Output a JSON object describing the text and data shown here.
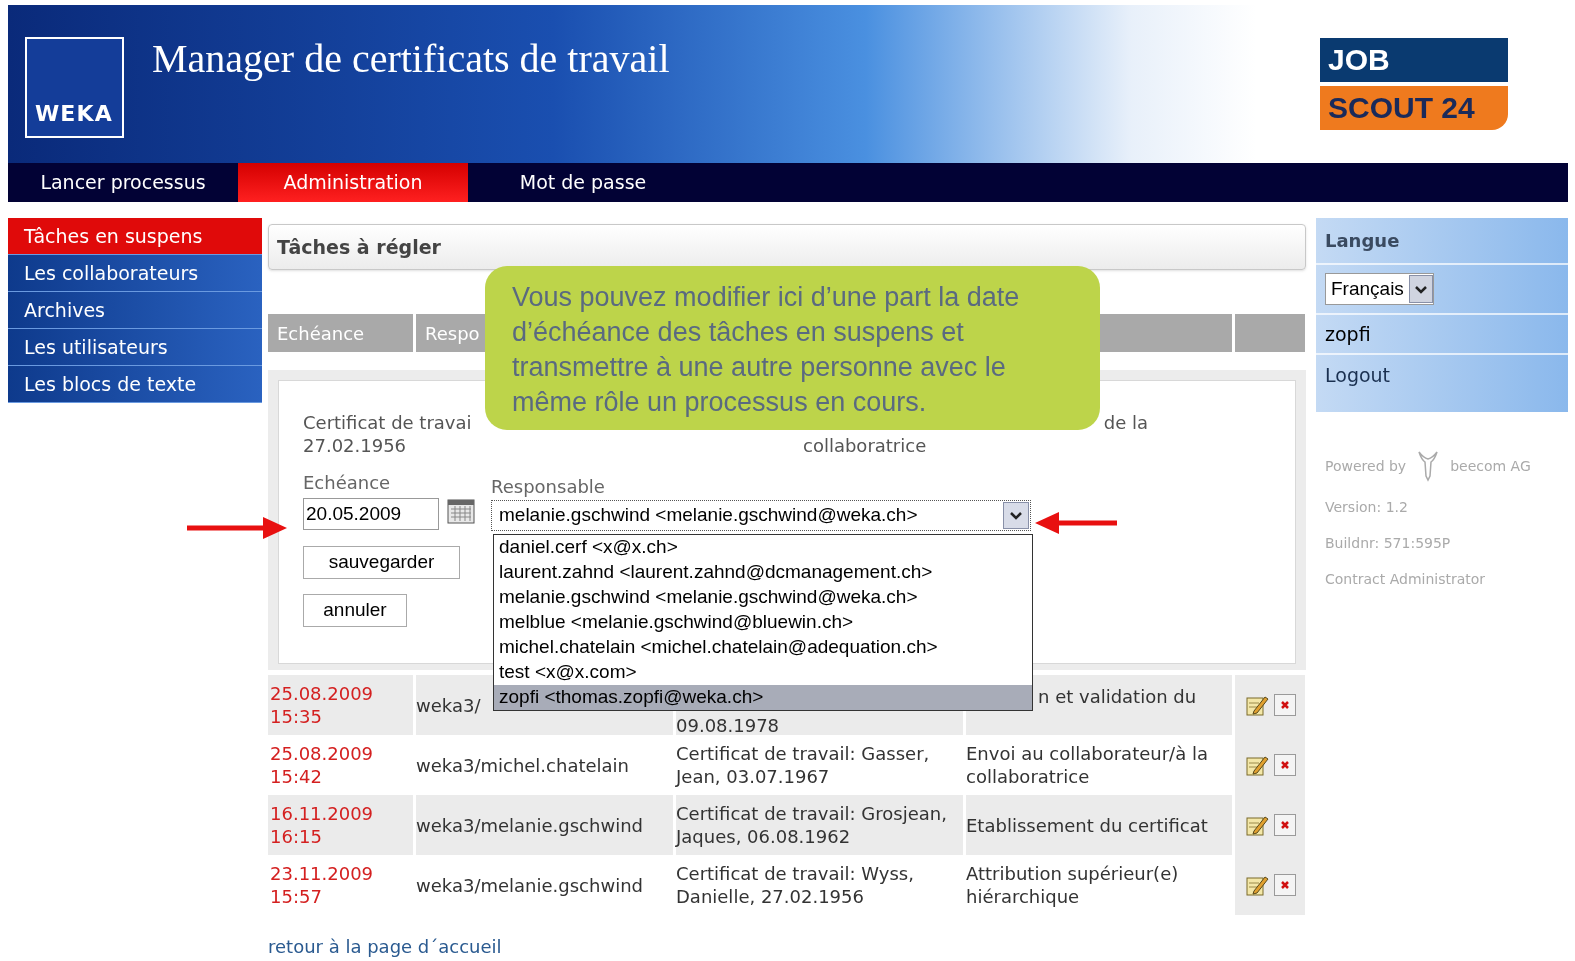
{
  "header": {
    "title": "Manager de certificats de travail",
    "logo_text": "WEKA",
    "partner_logo": {
      "line1": "JOB",
      "line2": "SCOUT 24"
    }
  },
  "nav": [
    {
      "label": "Lancer processus",
      "selected": false
    },
    {
      "label": "Administration",
      "selected": true
    },
    {
      "label": "Mot de passe",
      "selected": false
    }
  ],
  "sidebar": [
    {
      "label": "Tâches en suspens",
      "selected": true
    },
    {
      "label": "Les collaborateurs",
      "selected": false
    },
    {
      "label": "Archives",
      "selected": false
    },
    {
      "label": "Les utilisateurs",
      "selected": false
    },
    {
      "label": "Les blocs de texte",
      "selected": false
    }
  ],
  "panel_title": "Tâches à régler",
  "table": {
    "columns": [
      {
        "label": "Echéance"
      },
      {
        "label": "Respo"
      }
    ],
    "edit_form": {
      "certificate_lines": [
        "Certificat de travai",
        "27.02.1956"
      ],
      "task_lines": [
        "de la",
        "collaboratrice"
      ],
      "due_label": "Echéance",
      "due_value": "20.05.2009",
      "responsible_label": "Responsable",
      "responsible_value": "melanie.gschwind <melanie.gschwind@weka.ch>",
      "buttons": [
        "sauvegarder",
        "annuler"
      ],
      "options": [
        {
          "label": "daniel.cerf <x@x.ch>",
          "selected": false
        },
        {
          "label": "laurent.zahnd <laurent.zahnd@dcmanagement.ch>",
          "selected": false
        },
        {
          "label": "melanie.gschwind <melanie.gschwind@weka.ch>",
          "selected": false
        },
        {
          "label": "melblue <melanie.gschwind@bluewin.ch>",
          "selected": false
        },
        {
          "label": "michel.chatelain <michel.chatelain@adequation.ch>",
          "selected": false
        },
        {
          "label": "test <x@x.com>",
          "selected": false
        },
        {
          "label": "zopfi <thomas.zopfi@weka.ch>",
          "selected": true
        }
      ]
    },
    "rows": [
      {
        "date": "25.08.2009",
        "time": "15:35",
        "user": "weka3/",
        "certificate": "09.08.1978",
        "task": "n et validation du"
      },
      {
        "date": "25.08.2009",
        "time": "15:42",
        "user": "weka3/michel.chatelain",
        "certificate": "Certificat de travail: Gasser, Jean, 03.07.1967",
        "task": "Envoi au collaborateur/à la collaboratrice"
      },
      {
        "date": "16.11.2009",
        "time": "16:15",
        "user": "weka3/melanie.gschwind",
        "certificate": "Certificat de travail: Grosjean, Jaques, 06.08.1962",
        "task": "Etablissement du certificat"
      },
      {
        "date": "23.11.2009",
        "time": "15:57",
        "user": "weka3/melanie.gschwind",
        "certificate": "Certificat de travail: Wyss, Danielle, 27.02.1956",
        "task": "Attribution supérieur(e) hiérarchique"
      }
    ]
  },
  "back_link": "retour à la page d´accueil",
  "right_panel": {
    "language_label": "Langue",
    "language": "Français",
    "user": "zopfi",
    "logout": "Logout",
    "powered_by": "Powered by",
    "company": "beecom AG",
    "info_lines": [
      "Version: 1.2",
      "Buildnr: 571:595P",
      "Contract Administrator"
    ]
  },
  "callout": "Vous pouvez modifier ici d’une part la date d’échéance des tâches en suspens et transmettre à une autre personne avec le même rôle un processus en cours."
}
